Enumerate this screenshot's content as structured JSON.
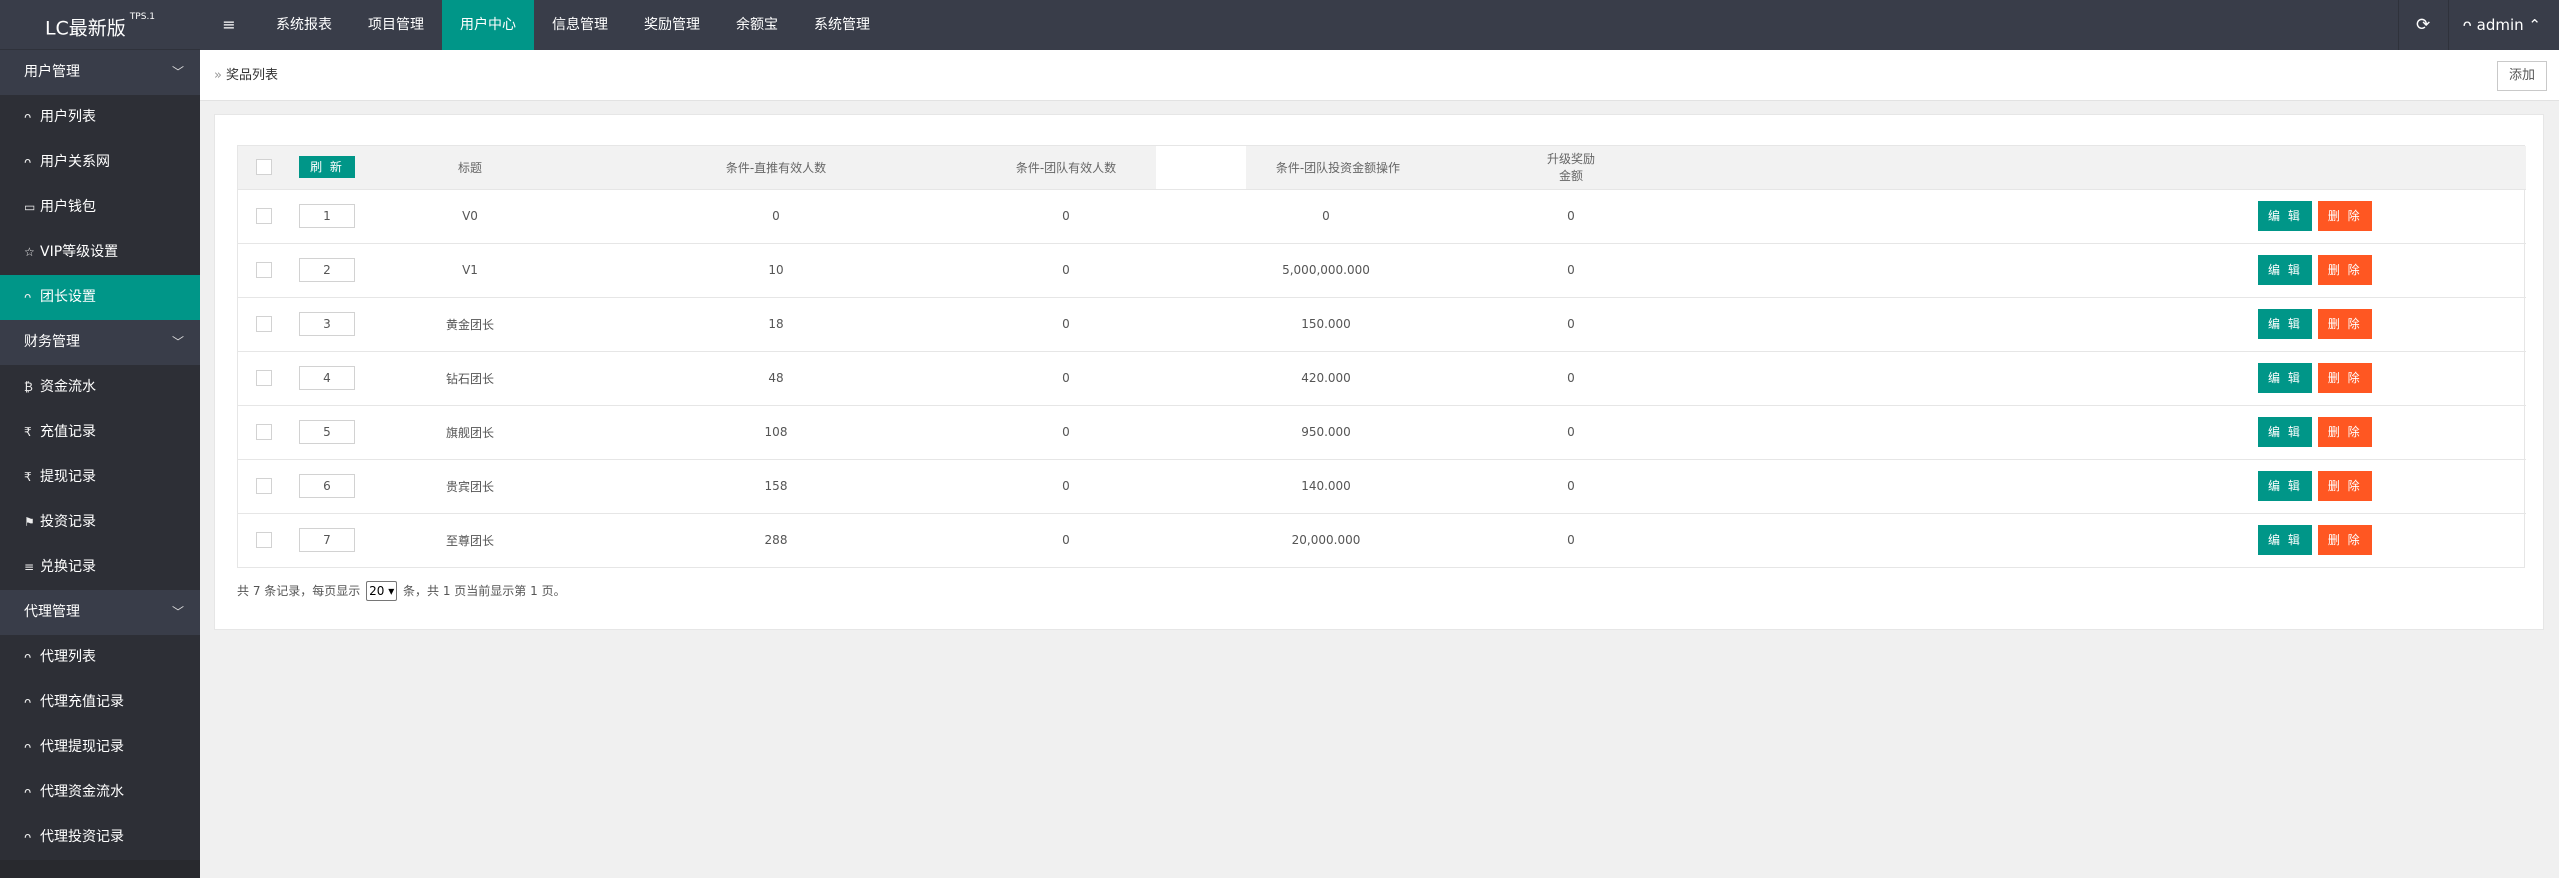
{
  "app": {
    "logo": "LC最新版",
    "version": "TPS.1",
    "menu_icon": "≡",
    "admin_label": "admin",
    "colors": {
      "primary": "#009688",
      "danger": "#ff5722",
      "header": "#393d49",
      "sidebar": "#28292e"
    }
  },
  "topnav": [
    {
      "label": "系统报表"
    },
    {
      "label": "项目管理"
    },
    {
      "label": "用户中心",
      "active": true
    },
    {
      "label": "信息管理"
    },
    {
      "label": "奖励管理"
    },
    {
      "label": "余额宝"
    },
    {
      "label": "系统管理"
    }
  ],
  "sidebar": {
    "groups": [
      {
        "title": "用户管理",
        "items": [
          {
            "label": "用户列表",
            "icon": "user-icon",
            "glyph": "ᴖ"
          },
          {
            "label": "用户关系网",
            "icon": "users-icon",
            "glyph": "ᴖ"
          },
          {
            "label": "用户钱包",
            "icon": "wallet-icon",
            "glyph": "▭"
          },
          {
            "label": "VIP等级设置",
            "icon": "star-icon",
            "glyph": "☆"
          },
          {
            "label": "团长设置",
            "icon": "users-icon",
            "glyph": "ᴖ",
            "active": true
          }
        ]
      },
      {
        "title": "财务管理",
        "items": [
          {
            "label": "资金流水",
            "icon": "bitcoin-icon",
            "glyph": "₿"
          },
          {
            "label": "充值记录",
            "icon": "rupee-icon",
            "glyph": "₹"
          },
          {
            "label": "提现记录",
            "icon": "rupee-icon",
            "glyph": "₹"
          },
          {
            "label": "投资记录",
            "icon": "flag-icon",
            "glyph": "⚑"
          },
          {
            "label": "兑换记录",
            "icon": "list-icon",
            "glyph": "≡"
          }
        ]
      },
      {
        "title": "代理管理",
        "items": [
          {
            "label": "代理列表",
            "icon": "user-icon",
            "glyph": "ᴖ"
          },
          {
            "label": "代理充值记录",
            "icon": "user-icon",
            "glyph": "ᴖ"
          },
          {
            "label": "代理提现记录",
            "icon": "user-icon",
            "glyph": "ᴖ"
          },
          {
            "label": "代理资金流水",
            "icon": "user-icon",
            "glyph": "ᴖ"
          },
          {
            "label": "代理投资记录",
            "icon": "user-icon",
            "glyph": "ᴖ"
          }
        ]
      }
    ]
  },
  "breadcrumb": {
    "separator": "»",
    "title": "奖品列表"
  },
  "toolbar": {
    "add_label": "添加"
  },
  "table": {
    "refresh_label": "刷 新",
    "headers": [
      "标题",
      "条件-直推有效人数",
      "条件-团队有效人数",
      "条件-团队投资金额",
      "升级奖励金额",
      "操作"
    ],
    "edit_label": "编 辑",
    "delete_label": "删 除",
    "rows": [
      {
        "sort": "1",
        "title": "V0",
        "direct": "0",
        "team": "0",
        "invest": "0",
        "reward": "0"
      },
      {
        "sort": "2",
        "title": "V1",
        "direct": "10",
        "team": "0",
        "invest": "5,000,000.000",
        "reward": "0"
      },
      {
        "sort": "3",
        "title": "黄金团长",
        "direct": "18",
        "team": "0",
        "invest": "150.000",
        "reward": "0"
      },
      {
        "sort": "4",
        "title": "钻石团长",
        "direct": "48",
        "team": "0",
        "invest": "420.000",
        "reward": "0"
      },
      {
        "sort": "5",
        "title": "旗舰团长",
        "direct": "108",
        "team": "0",
        "invest": "950.000",
        "reward": "0"
      },
      {
        "sort": "6",
        "title": "贵宾团长",
        "direct": "158",
        "team": "0",
        "invest": "140.000",
        "reward": "0"
      },
      {
        "sort": "7",
        "title": "至尊团长",
        "direct": "288",
        "team": "0",
        "invest": "20,000.000",
        "reward": "0"
      }
    ]
  },
  "pager": {
    "prefix": "共 7 条记录，每页显示",
    "page_size": "20",
    "suffix": "条，共 1 页当前显示第 1 页。"
  }
}
